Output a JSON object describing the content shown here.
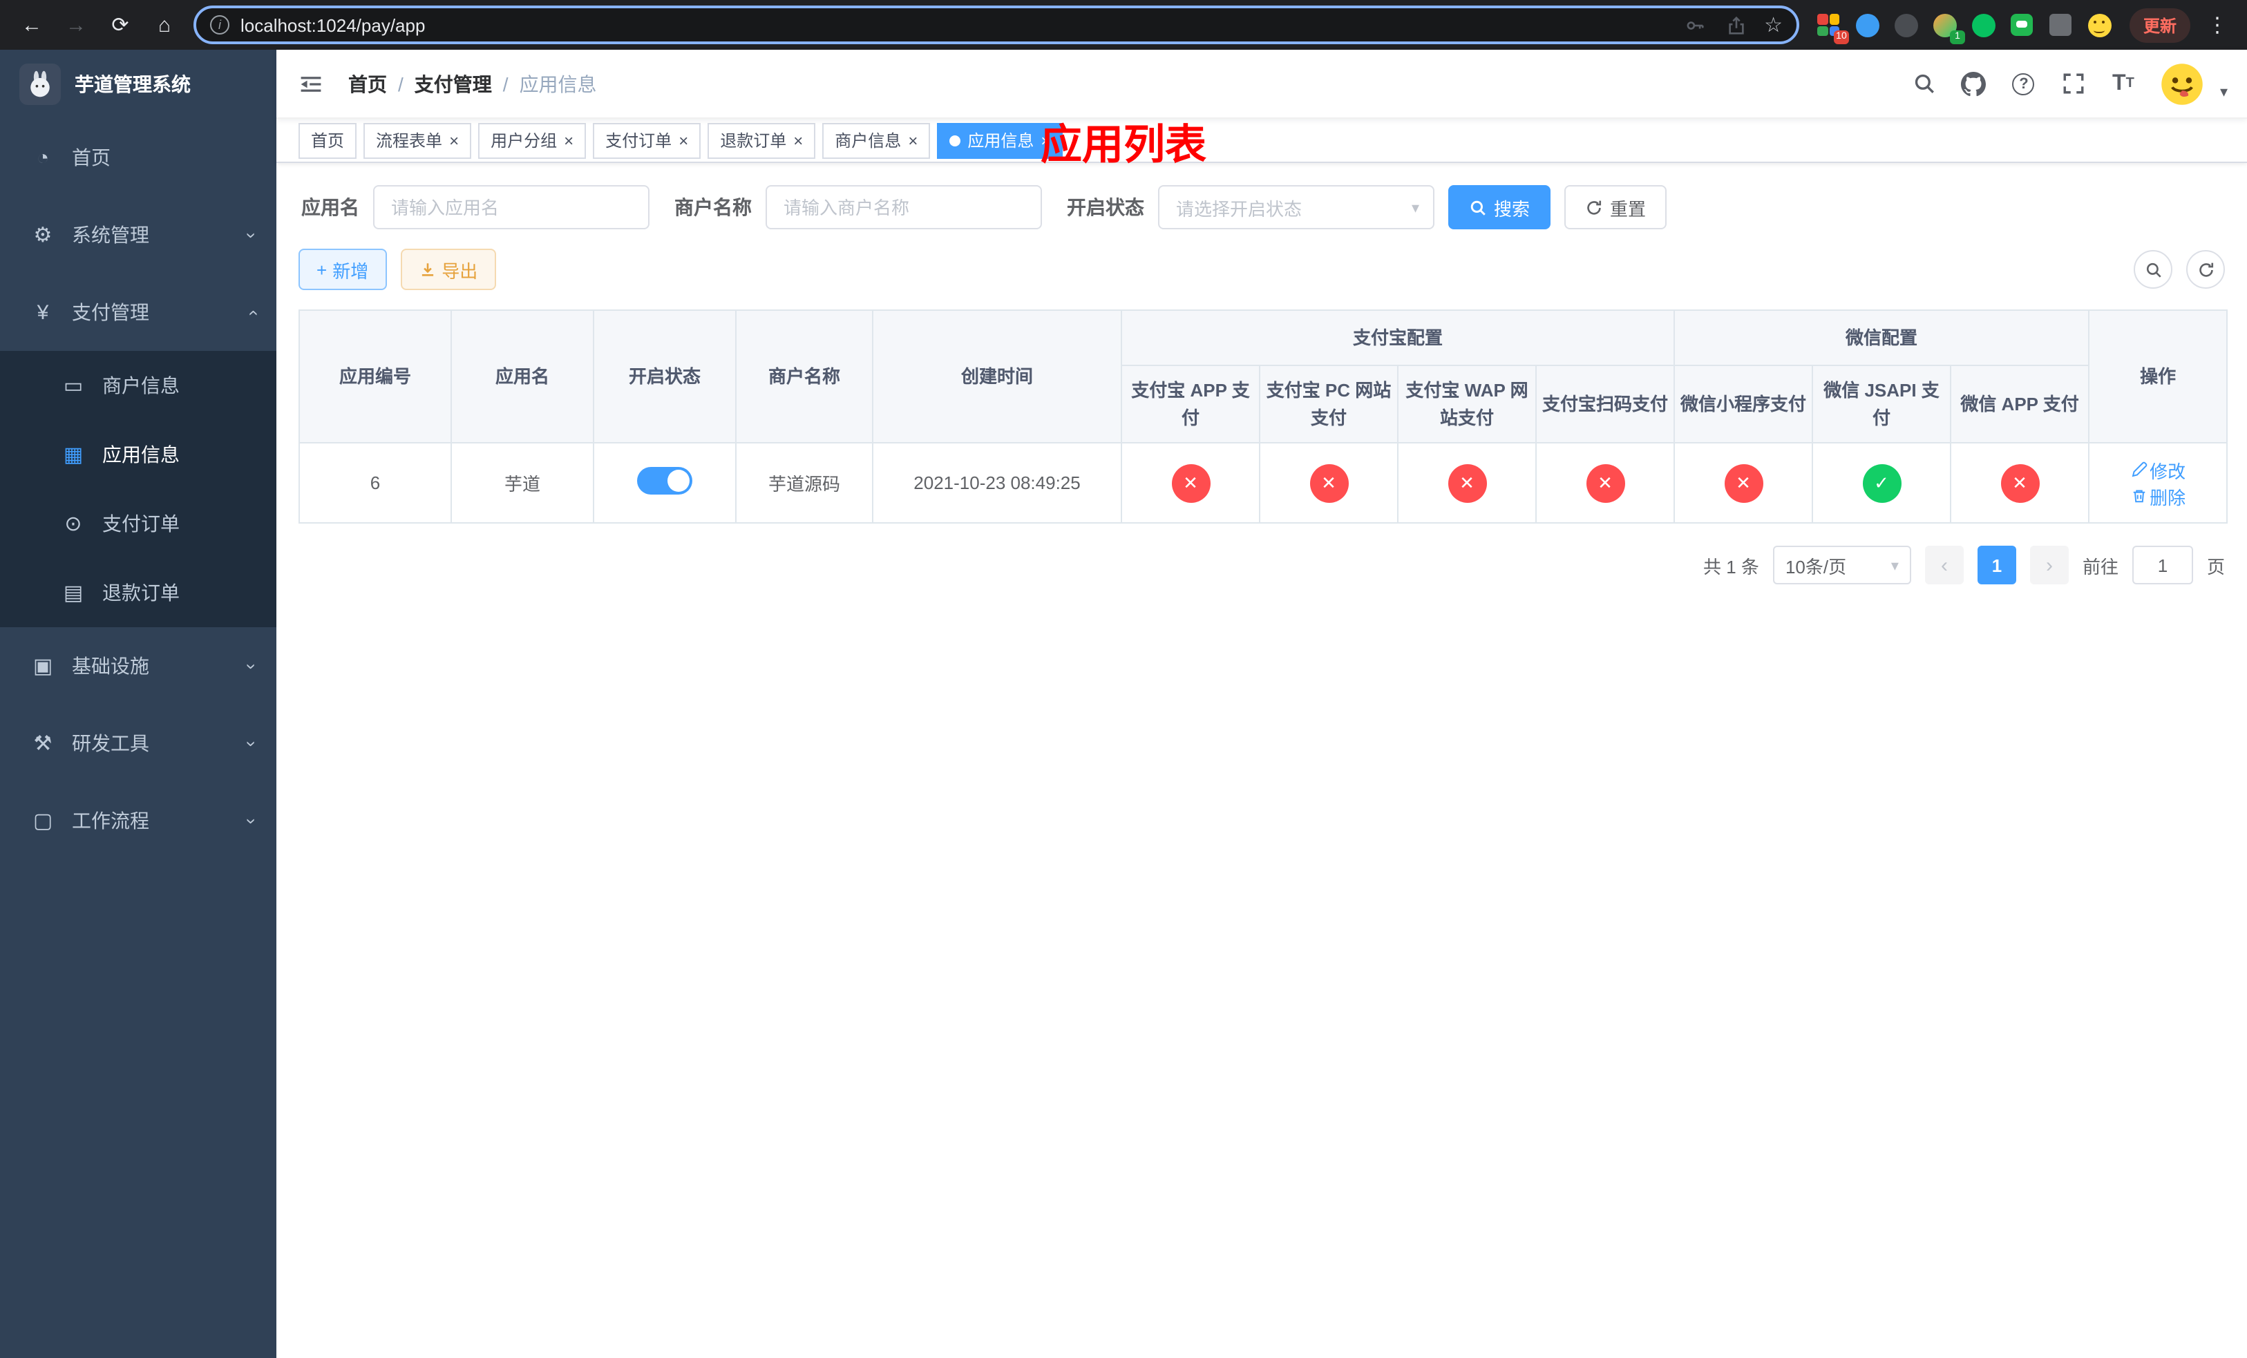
{
  "ui": {
    "close_glyph": "×",
    "check_glyph": "✓",
    "cross_glyph": "✕",
    "chevron_glyph": "›",
    "back_glyph": "←",
    "forward_glyph": "→",
    "reload_glyph": "⟳",
    "home_glyph": "⌂",
    "star_glyph": "☆",
    "dots_glyph": "⋮",
    "info_glyph": "i",
    "caret_glyph": "▾",
    "help_glyph": "?",
    "plus_glyph": "+",
    "font_icon_large": "T",
    "font_icon_small": "T",
    "dash_icon": "◔",
    "gear_icon": "⚙",
    "yen_icon": "¥",
    "card_icon": "▭",
    "grid_icon": "▦",
    "order_icon": "⊙",
    "doc_icon": "▤",
    "infra_icon": "▣",
    "tool_icon": "⚒",
    "flow_icon": "▢",
    "prev_glyph": "‹",
    "next_glyph": "›"
  },
  "colors": {
    "accent": "#409eff",
    "success": "#13ce66",
    "danger": "#ff4d4f",
    "warning": "#e6a23c",
    "title_red": "#ff0000",
    "sidebar_bg": "#304156",
    "submenu_bg": "#1f2d3d"
  },
  "browser": {
    "url": "localhost:1024/pay/app",
    "update_label": "更新",
    "ext_badge_red": "10",
    "ext_badge_green": "1"
  },
  "sidebar": {
    "title": "芋道管理系统",
    "home": "首页",
    "system": "系统管理",
    "payment": "支付管理",
    "merchant": "商户信息",
    "app": "应用信息",
    "order": "支付订单",
    "refund": "退款订单",
    "infra": "基础设施",
    "devtools": "研发工具",
    "workflow": "工作流程"
  },
  "header": {
    "crumb_home": "首页",
    "crumb_payment": "支付管理",
    "crumb_app": "应用信息",
    "separator": "/",
    "page_title": "应用列表"
  },
  "tabs": [
    {
      "label": "首页"
    },
    {
      "label": "流程表单"
    },
    {
      "label": "用户分组"
    },
    {
      "label": "支付订单"
    },
    {
      "label": "退款订单"
    },
    {
      "label": "商户信息"
    },
    {
      "label": "应用信息"
    }
  ],
  "filters": {
    "app_name_label": "应用名",
    "app_name_placeholder": "请输入应用名",
    "merchant_label": "商户名称",
    "merchant_placeholder": "请输入商户名称",
    "status_label": "开启状态",
    "status_placeholder": "请选择开启状态",
    "search_label": "搜索",
    "reset_label": "重置"
  },
  "toolbar": {
    "add_label": "新增",
    "export_label": "导出"
  },
  "table": {
    "col_id": "应用编号",
    "col_name": "应用名",
    "col_status": "开启状态",
    "col_merchant": "商户名称",
    "col_created": "创建时间",
    "col_action": "操作",
    "group_alipay": "支付宝配置",
    "group_wechat": "微信配置",
    "sub_alipay_app": "支付宝 APP 支付",
    "sub_alipay_pc": "支付宝 PC 网站支付",
    "sub_alipay_wap": "支付宝 WAP 网站支付",
    "sub_alipay_qr": "支付宝扫码支付",
    "sub_wx_lite": "微信小程序支付",
    "sub_wx_jsapi": "微信 JSAPI 支付",
    "sub_wx_app": "微信 APP 支付",
    "edit_label": "修改",
    "delete_label": "删除",
    "rows": [
      {
        "id": "6",
        "name": "芋道",
        "enabled": true,
        "merchant": "芋道源码",
        "created": "2021-10-23 08:49:25",
        "alipay_app": false,
        "alipay_pc": false,
        "alipay_wap": false,
        "alipay_qr": false,
        "wx_lite": false,
        "wx_jsapi": true,
        "wx_app": false
      }
    ]
  },
  "pagination": {
    "total": "共 1 条",
    "size": "10条/页",
    "current": "1",
    "goto": "前往",
    "page_unit": "页",
    "goto_value": "1"
  }
}
